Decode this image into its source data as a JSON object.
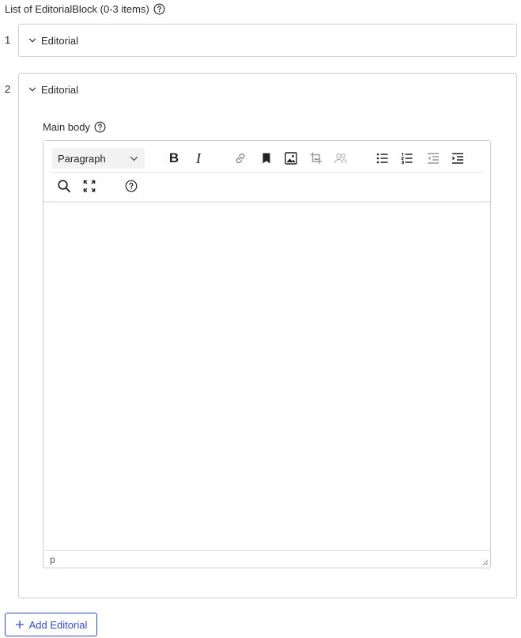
{
  "list": {
    "header": "List of EditorialBlock (0-3 items)",
    "help_icon": "help-circle-icon"
  },
  "items": [
    {
      "index": "1",
      "title": "Editorial",
      "expanded": false
    },
    {
      "index": "2",
      "title": "Editorial",
      "expanded": true
    }
  ],
  "editor": {
    "field_label": "Main body",
    "block_format": "Paragraph",
    "bold_label": "B",
    "italic_label": "I",
    "toolbar_icons": [
      "link-icon",
      "bookmark-icon",
      "image-icon",
      "crop-icon",
      "people-icon",
      "bullet-list-icon",
      "numbered-list-icon",
      "outdent-icon",
      "indent-icon",
      "search-icon",
      "fullscreen-icon",
      "help-icon"
    ],
    "status_path": "p"
  },
  "actions": {
    "add_label": "Add Editorial"
  },
  "colors": {
    "accent": "#2f4bc7",
    "border": "#cfcfcf",
    "muted_icon": "#9a9a9a"
  }
}
